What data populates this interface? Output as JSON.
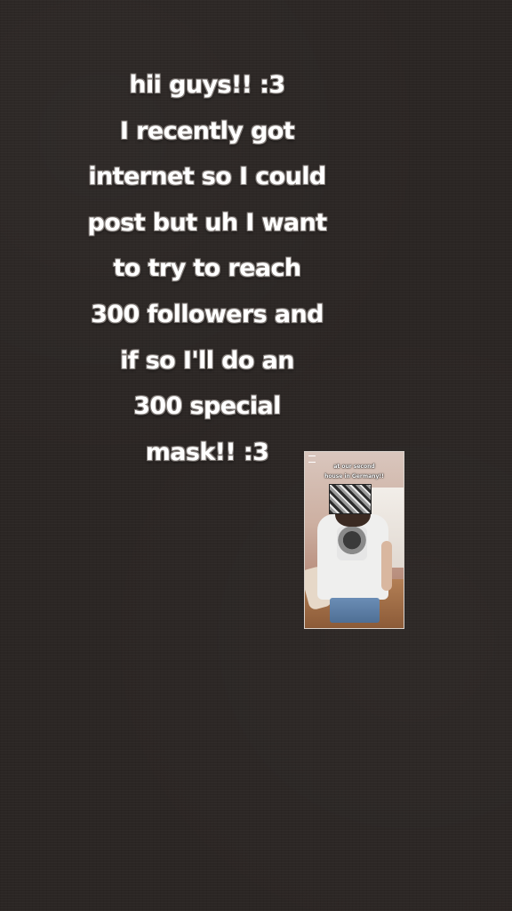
{
  "story": {
    "caption_lines": [
      "hii guys!! :3",
      "I recently got",
      "internet so I could",
      "post but uh I want",
      "to try to reach",
      "300 followers and",
      "if so I'll do an",
      "300 special",
      "mask!! :3"
    ],
    "text_color": "#ffffff",
    "background_color": "#2b2624"
  },
  "sticker": {
    "label_line_1": "at our second",
    "label_line_2": "house in Germany!!",
    "icon": "menu-icon"
  }
}
